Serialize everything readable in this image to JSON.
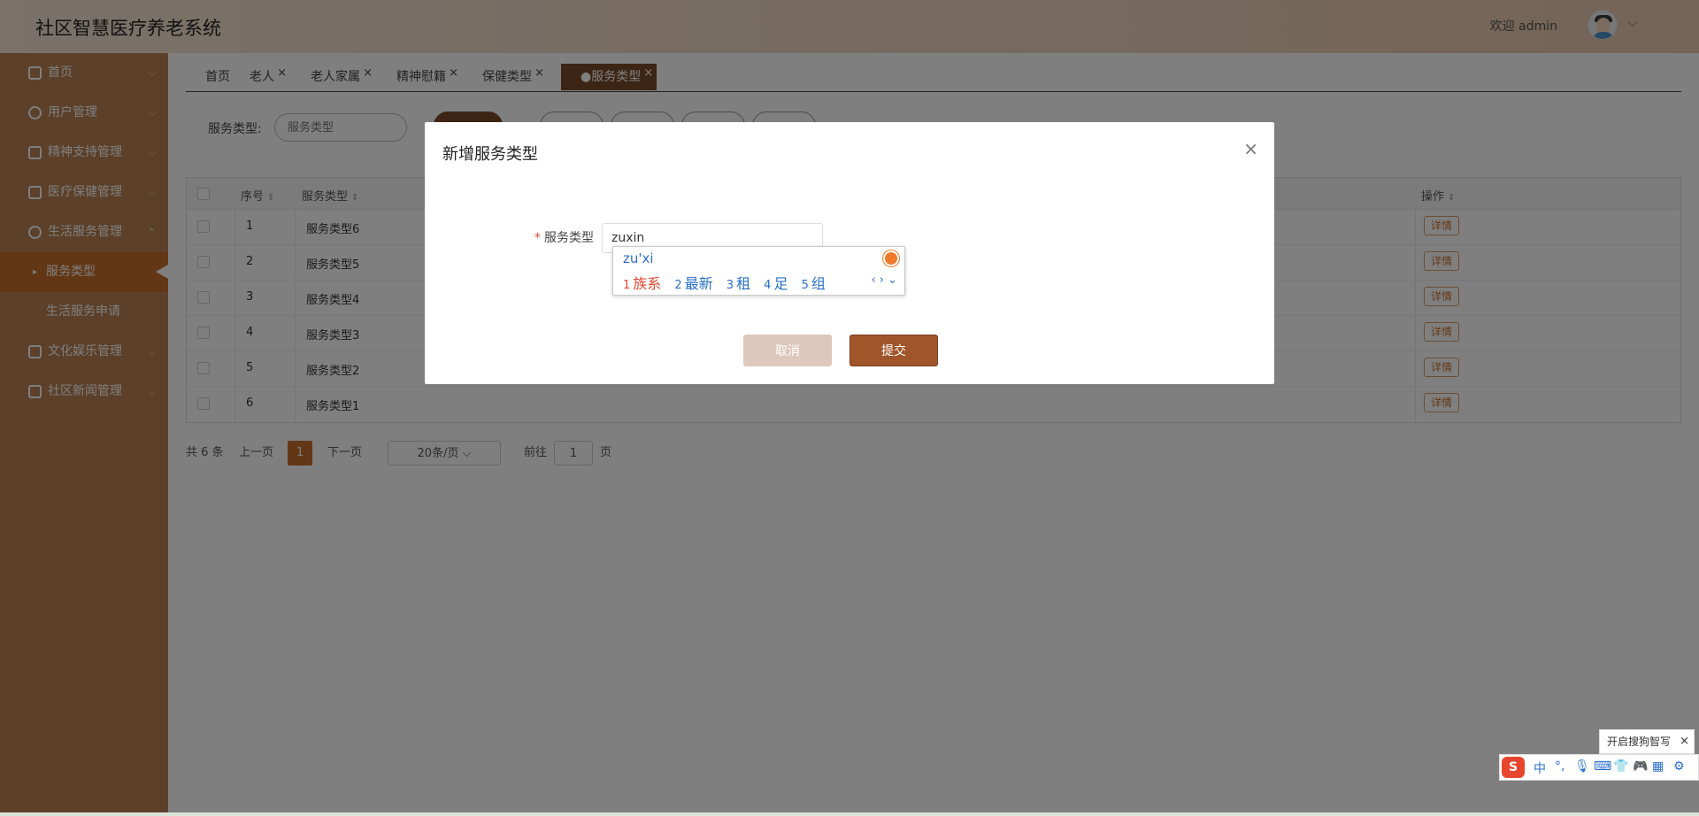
{
  "app": {
    "title": "社区智慧医疗养老系统",
    "welcome": "欢迎 admin"
  },
  "sidebar": {
    "items": [
      {
        "label": "首页",
        "icon": "home-icon"
      },
      {
        "label": "用户管理",
        "icon": "user-icon"
      },
      {
        "label": "精神支持管理",
        "icon": "heart-icon"
      },
      {
        "label": "医疗保健管理",
        "icon": "medical-icon"
      },
      {
        "label": "生活服务管理",
        "icon": "service-icon"
      }
    ],
    "subitems": [
      {
        "label": "服务类型"
      },
      {
        "label": "生活服务申请"
      }
    ],
    "items_after": [
      {
        "label": "文化娱乐管理",
        "icon": "culture-icon"
      },
      {
        "label": "社区新闻管理",
        "icon": "news-icon"
      }
    ]
  },
  "tabs": [
    "首页",
    "老人",
    "老人家属",
    "精神慰籍",
    "保健类型",
    "●服务类型"
  ],
  "search": {
    "label": "服务类型:",
    "placeholder": "服务类型"
  },
  "table": {
    "headers": [
      "序号",
      "服务类型",
      "操作"
    ],
    "rows": [
      {
        "index": "1",
        "name": "服务类型6",
        "action": "详情"
      },
      {
        "index": "2",
        "name": "服务类型5",
        "action": "详情"
      },
      {
        "index": "3",
        "name": "服务类型4",
        "action": "详情"
      },
      {
        "index": "4",
        "name": "服务类型3",
        "action": "详情"
      },
      {
        "index": "5",
        "name": "服务类型2",
        "action": "详情"
      },
      {
        "index": "6",
        "name": "服务类型1",
        "action": "详情"
      }
    ]
  },
  "pagination": {
    "total": "共 6 条",
    "prev": "上一页",
    "current": "1",
    "next": "下一页",
    "page_size": "20条/页",
    "goto": "前往",
    "goto_value": "1",
    "page_unit": "页"
  },
  "modal": {
    "title": "新增服务类型",
    "field_label": "服务类型",
    "field_value": "zuxin",
    "cancel": "取消",
    "submit": "提交"
  },
  "ime": {
    "pinyin": "zu'xi",
    "candidates": [
      {
        "n": "1",
        "text": "族系"
      },
      {
        "n": "2",
        "text": "最新"
      },
      {
        "n": "3",
        "text": "租"
      },
      {
        "n": "4",
        "text": "足"
      },
      {
        "n": "5",
        "text": "组"
      }
    ],
    "tip": "开启搜狗智写",
    "toolbar_lang": "中"
  },
  "colors": {
    "accent": "#c66f2b",
    "sidebar": "#b88053",
    "submit": "#a0552b"
  }
}
